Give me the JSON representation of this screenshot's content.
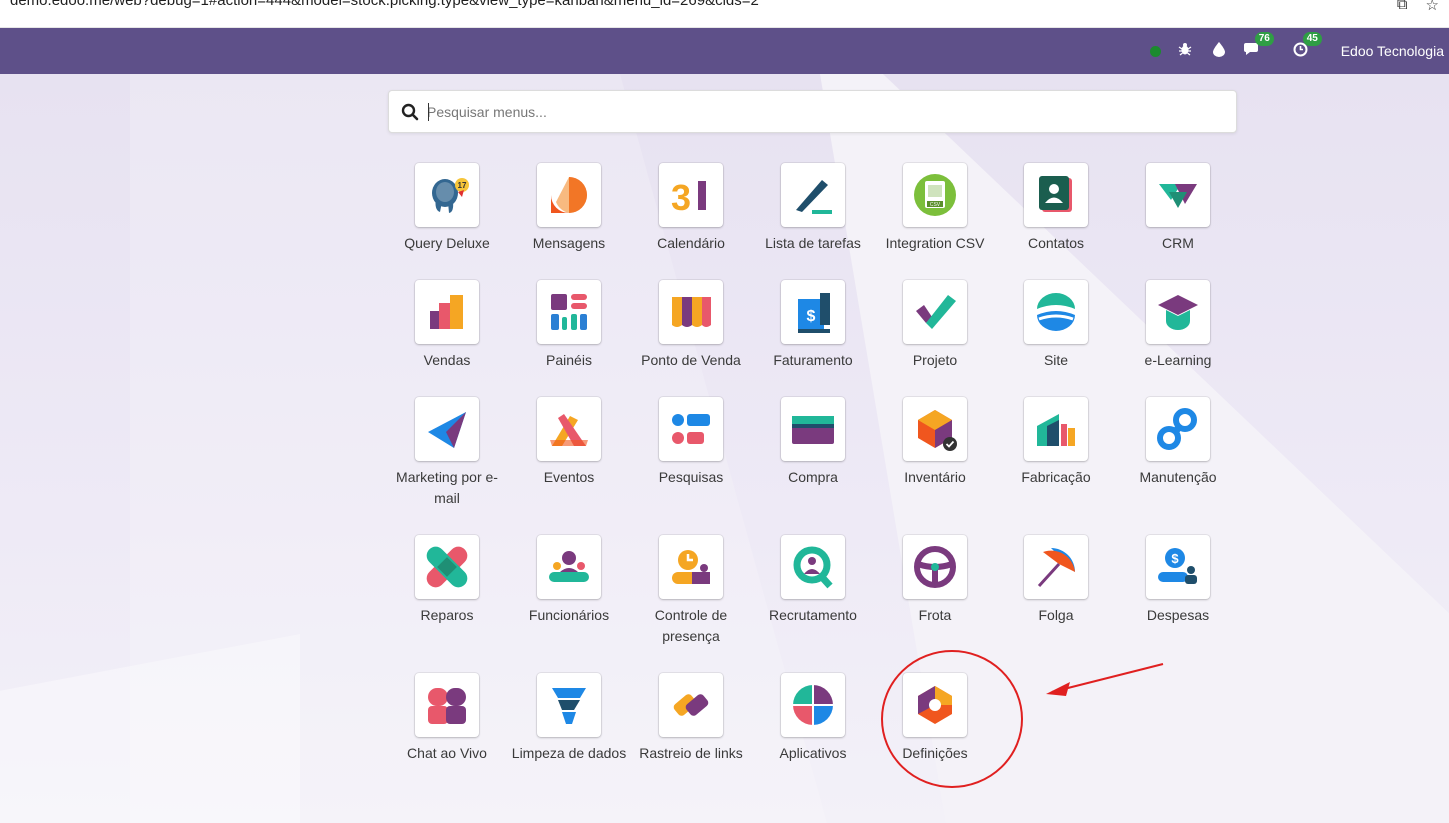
{
  "browser": {
    "url": "demo.edoo.me/web?debug=1#action=444&model=stock.picking.type&view_type=kanban&menu_id=269&cids=2"
  },
  "navbar": {
    "messages_count": "76",
    "activities_count": "45",
    "company": "Edoo Tecnologia"
  },
  "search": {
    "placeholder": "Pesquisar menus..."
  },
  "apps": [
    {
      "label": "Query Deluxe",
      "icon": "postgres-elephant-icon"
    },
    {
      "label": "Mensagens",
      "icon": "discuss-bubble-icon"
    },
    {
      "label": "Calendário",
      "icon": "calendar-31-icon"
    },
    {
      "label": "Lista de tarefas",
      "icon": "todo-pen-icon"
    },
    {
      "label": "Integration CSV",
      "icon": "csv-file-icon"
    },
    {
      "label": "Contatos",
      "icon": "contact-card-icon"
    },
    {
      "label": "CRM",
      "icon": "crm-handshake-icon"
    },
    {
      "label": "Vendas",
      "icon": "sales-chart-icon"
    },
    {
      "label": "Painéis",
      "icon": "dashboard-blocks-icon"
    },
    {
      "label": "Ponto de Venda",
      "icon": "pos-awning-icon"
    },
    {
      "label": "Faturamento",
      "icon": "invoice-dollar-icon"
    },
    {
      "label": "Projeto",
      "icon": "project-check-icon"
    },
    {
      "label": "Site",
      "icon": "website-globe-icon"
    },
    {
      "label": "e-Learning",
      "icon": "graduation-cap-icon"
    },
    {
      "label": "Marketing por e-mail",
      "icon": "paper-plane-icon"
    },
    {
      "label": "Eventos",
      "icon": "events-ribbon-icon"
    },
    {
      "label": "Pesquisas",
      "icon": "survey-bars-icon"
    },
    {
      "label": "Compra",
      "icon": "purchase-card-icon"
    },
    {
      "label": "Inventário",
      "icon": "inventory-box-icon"
    },
    {
      "label": "Fabricação",
      "icon": "manufacturing-factory-icon"
    },
    {
      "label": "Manutenção",
      "icon": "maintenance-wrench-icon"
    },
    {
      "label": "Reparos",
      "icon": "repair-bandage-icon"
    },
    {
      "label": "Funcionários",
      "icon": "employees-people-icon"
    },
    {
      "label": "Controle de presença",
      "icon": "attendance-clock-icon"
    },
    {
      "label": "Recrutamento",
      "icon": "recruitment-search-icon"
    },
    {
      "label": "Frota",
      "icon": "fleet-steering-wheel-icon"
    },
    {
      "label": "Folga",
      "icon": "time-off-umbrella-icon"
    },
    {
      "label": "Despesas",
      "icon": "expenses-coin-icon"
    },
    {
      "label": "Chat ao Vivo",
      "icon": "live-chat-icon"
    },
    {
      "label": "Limpeza de dados",
      "icon": "data-cleaning-icon"
    },
    {
      "label": "Rastreio de links",
      "icon": "link-tracker-icon"
    },
    {
      "label": "Aplicativos",
      "icon": "apps-quadrants-icon"
    },
    {
      "label": "Definições",
      "icon": "settings-hexagon-icon"
    }
  ],
  "colors": {
    "navbar": "#5e5089",
    "annotation": "#e02020"
  }
}
